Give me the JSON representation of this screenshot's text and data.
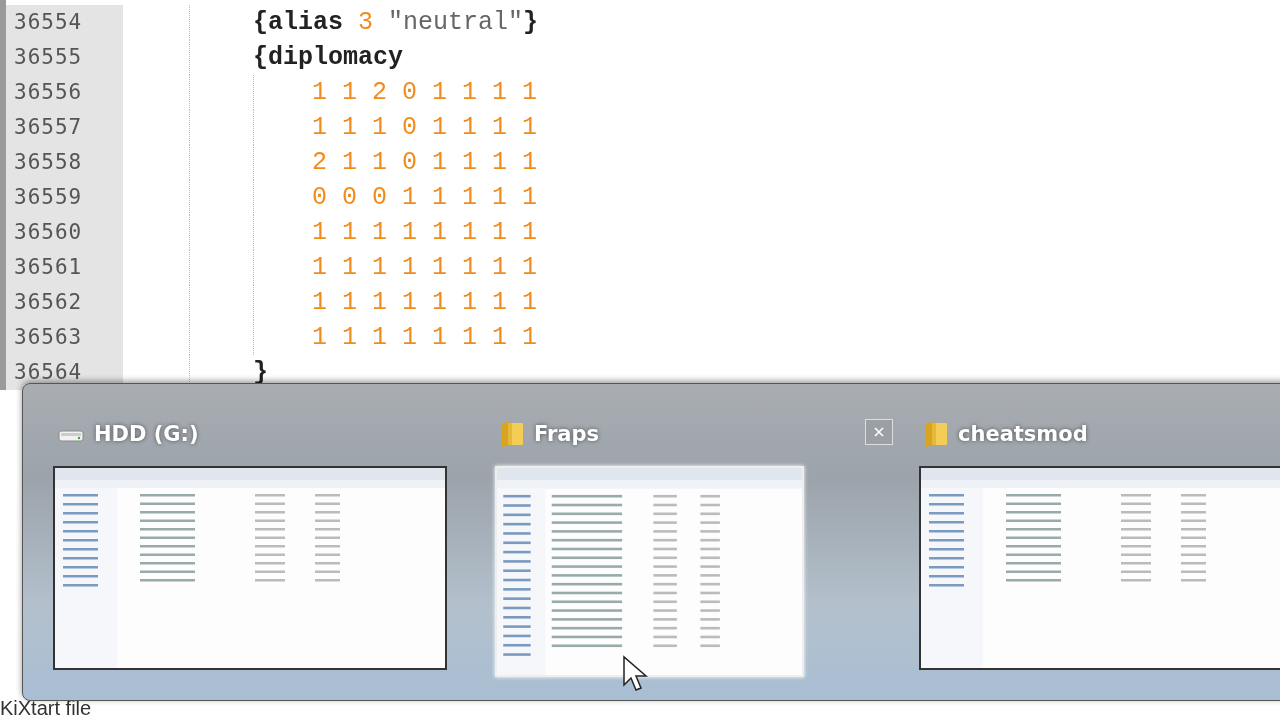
{
  "editor": {
    "lines": [
      {
        "number": "36554",
        "in_block": false,
        "tokens": [
          {
            "text": "{alias",
            "kind": "plain"
          },
          {
            "text": "3",
            "kind": "number"
          },
          {
            "text": "\"neutral\"",
            "kind": "string"
          },
          {
            "text": "}",
            "kind": "plain"
          }
        ]
      },
      {
        "number": "36555",
        "in_block": false,
        "tokens": [
          {
            "text": "{diplomacy",
            "kind": "plain"
          }
        ]
      },
      {
        "number": "36556",
        "in_block": true,
        "tokens": [
          {
            "text": "1 1 2 0 1 1 1 1",
            "kind": "number"
          }
        ]
      },
      {
        "number": "36557",
        "in_block": true,
        "tokens": [
          {
            "text": "1 1 1 0 1 1 1 1",
            "kind": "number"
          }
        ]
      },
      {
        "number": "36558",
        "in_block": true,
        "tokens": [
          {
            "text": "2 1 1 0 1 1 1 1",
            "kind": "number"
          }
        ]
      },
      {
        "number": "36559",
        "in_block": true,
        "tokens": [
          {
            "text": "0 0 0 1 1 1 1 1",
            "kind": "number"
          }
        ]
      },
      {
        "number": "36560",
        "in_block": true,
        "tokens": [
          {
            "text": "1 1 1 1 1 1 1 1",
            "kind": "number"
          }
        ]
      },
      {
        "number": "36561",
        "in_block": true,
        "tokens": [
          {
            "text": "1 1 1 1 1 1 1 1",
            "kind": "number"
          }
        ]
      },
      {
        "number": "36562",
        "in_block": true,
        "tokens": [
          {
            "text": "1 1 1 1 1 1 1 1",
            "kind": "number"
          }
        ]
      },
      {
        "number": "36563",
        "in_block": true,
        "tokens": [
          {
            "text": "1 1 1 1 1 1 1 1",
            "kind": "number"
          }
        ]
      },
      {
        "number": "36564",
        "in_block": false,
        "tokens": [
          {
            "text": "}",
            "kind": "plain"
          }
        ]
      }
    ]
  },
  "status_bar": {
    "file_type": "KiXtart file"
  },
  "taskbar_preview": {
    "windows": [
      {
        "title": "HDD (G:)",
        "kind": "drive",
        "selected": false
      },
      {
        "title": "Fraps",
        "kind": "folder",
        "selected": true
      },
      {
        "title": "cheatsmod",
        "kind": "folder",
        "selected": false
      }
    ]
  }
}
